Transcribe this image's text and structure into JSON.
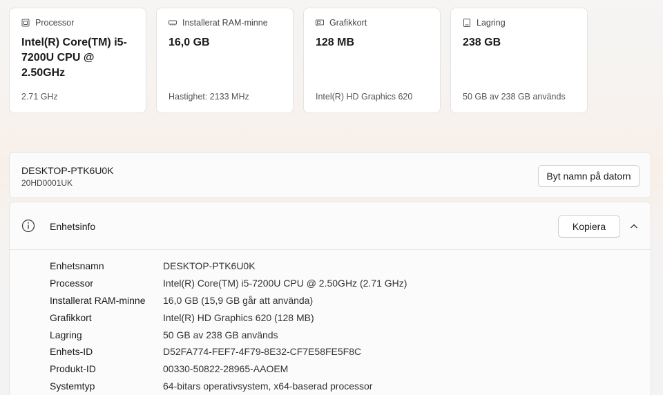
{
  "cards": [
    {
      "title": "Processor",
      "icon": "cpu-icon",
      "value": "Intel(R) Core(TM) i5-7200U CPU @ 2.50GHz",
      "sub": "2.71 GHz"
    },
    {
      "title": "Installerat RAM-minne",
      "icon": "memory-icon",
      "value": "16,0 GB",
      "sub": "Hastighet: 2133 MHz"
    },
    {
      "title": "Grafikkort",
      "icon": "graphics-card-icon",
      "value": "128 MB",
      "sub": "Intel(R) HD Graphics 620"
    },
    {
      "title": "Lagring",
      "icon": "storage-icon",
      "value": "238 GB",
      "sub": "50 GB av 238 GB används"
    }
  ],
  "device": {
    "name": "DESKTOP-PTK6U0K",
    "model": "20HD0001UK",
    "rename_label": "Byt namn på datorn"
  },
  "device_info": {
    "title": "Enhetsinfo",
    "copy_label": "Kopiera",
    "rows": [
      {
        "label": "Enhetsnamn",
        "value": "DESKTOP-PTK6U0K"
      },
      {
        "label": "Processor",
        "value": "Intel(R) Core(TM) i5-7200U CPU @ 2.50GHz (2.71 GHz)"
      },
      {
        "label": "Installerat RAM-minne",
        "value": "16,0 GB (15,9 GB går att använda)"
      },
      {
        "label": "Grafikkort",
        "value": "Intel(R) HD Graphics 620 (128 MB)"
      },
      {
        "label": "Lagring",
        "value": "50 GB av 238 GB används"
      },
      {
        "label": "Enhets-ID",
        "value": "D52FA774-FEF7-4F79-8E32-CF7E58FE5F8C"
      },
      {
        "label": "Produkt-ID",
        "value": "00330-50822-28965-AAOEM"
      },
      {
        "label": "Systemtyp",
        "value": "64-bitars operativsystem, x64-baserad processor"
      }
    ]
  }
}
